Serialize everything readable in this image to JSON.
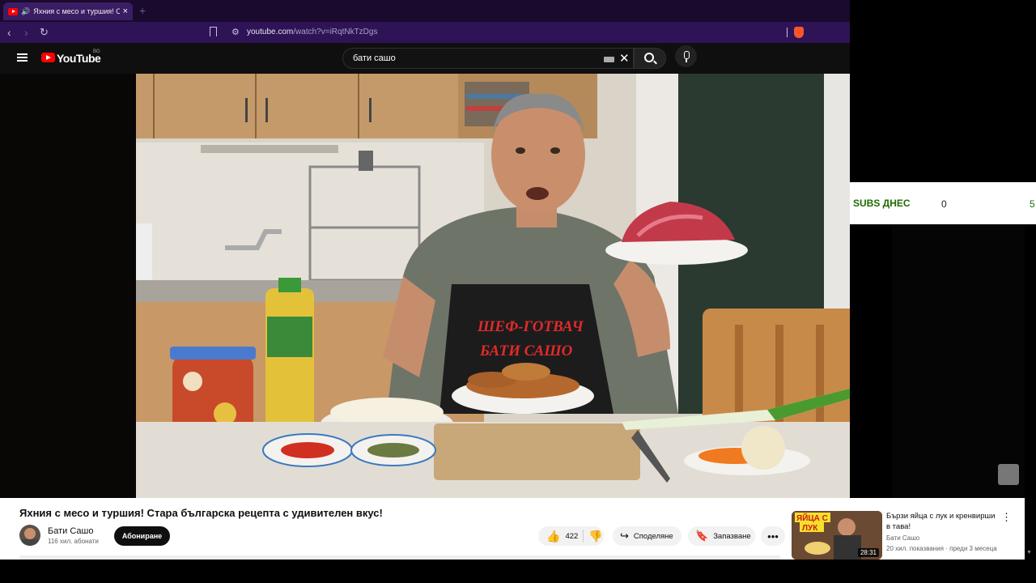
{
  "browser": {
    "tab_title": "Яхния с месо и туршия! Ста",
    "new_tab": "+",
    "url_host": "youtube.com",
    "url_path": "/watch?v=iRqtNkTzDgs"
  },
  "youtube": {
    "logo_text": "YouTube",
    "region": "BG",
    "search_query": "бати сашо"
  },
  "widget": {
    "label": "SUBS ДНЕС",
    "value1": "0",
    "value2": "5"
  },
  "video": {
    "apron_line1": "ШЕФ-ГОТВАЧ",
    "apron_line2": "БАТИ САШО",
    "title": "Яхния с месо и туршия! Стара българска рецепта с удивителен вкус!",
    "channel": "Бати Сашо",
    "subscribers": "116 хил. абонати",
    "subscribe_label": "Абониране",
    "likes": "422",
    "share_label": "Споделяне",
    "save_label": "Запазване",
    "more_label": "•••"
  },
  "recommended": {
    "title": "Бързи яйца с лук и кренвирши в тава!",
    "channel": "Бати Сашо",
    "meta": "20 хил. показвания · преди 3 месеца",
    "duration": "28:31",
    "thumb_text1": "ЯЙЦА С",
    "thumb_text2": "ЛУК"
  }
}
